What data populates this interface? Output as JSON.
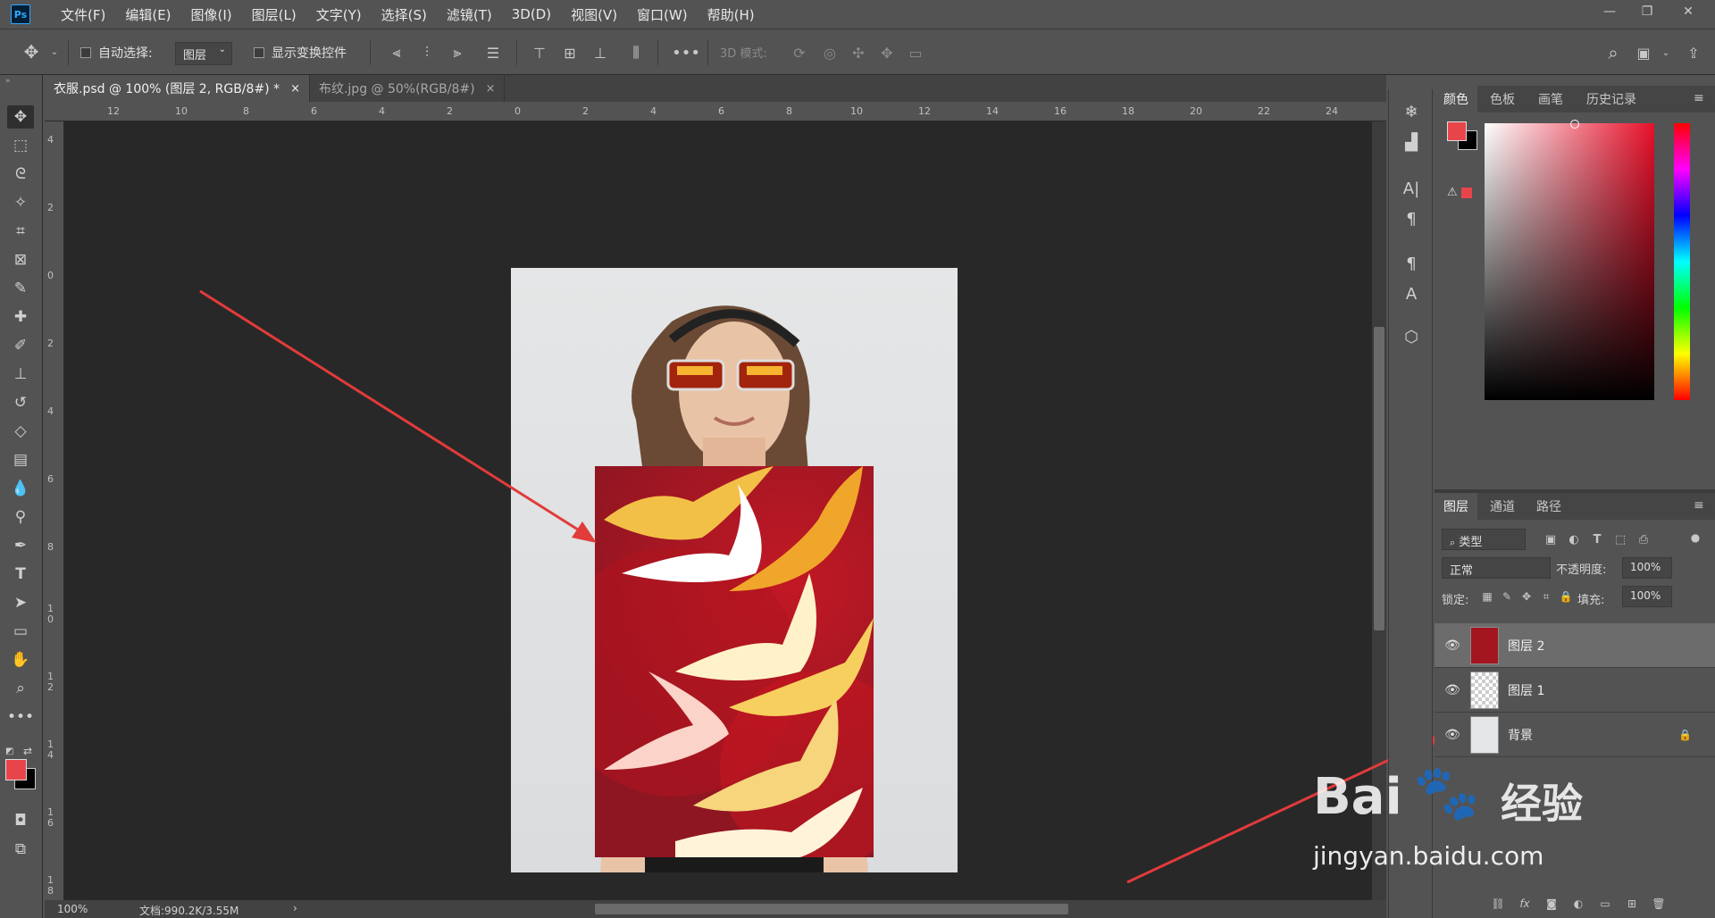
{
  "app": {
    "logo": "Ps"
  },
  "menu": [
    "文件(F)",
    "编辑(E)",
    "图像(I)",
    "图层(L)",
    "文字(Y)",
    "选择(S)",
    "滤镜(T)",
    "3D(D)",
    "视图(V)",
    "窗口(W)",
    "帮助(H)"
  ],
  "window_controls": {
    "minimize": "—",
    "restore": "❐",
    "close": "✕"
  },
  "options": {
    "auto_select_label": "自动选择:",
    "auto_select_value": "图层",
    "show_transform_label": "显示变换控件",
    "mode_3d_label": "3D 模式:"
  },
  "tabs": [
    {
      "label": "衣服.psd @ 100% (图层 2, RGB/8#) *",
      "close": "×"
    },
    {
      "label": "布纹.jpg @ 50%(RGB/8#)",
      "close": "×"
    }
  ],
  "ruler_h": [
    "12",
    "10",
    "8",
    "6",
    "4",
    "2",
    "0",
    "2",
    "4",
    "6",
    "8",
    "10",
    "12",
    "14",
    "16",
    "18",
    "20",
    "22",
    "24"
  ],
  "ruler_v": [
    "4",
    "2",
    "0",
    "2",
    "4",
    "6",
    "8",
    "1 0",
    "1 2",
    "1 4",
    "1 6",
    "1 8"
  ],
  "status": {
    "zoom": "100%",
    "doc_info": "文档:990.2K/3.55M",
    "arrow": "›"
  },
  "color_panel": {
    "tabs": [
      "颜色",
      "色板",
      "画笔",
      "历史记录"
    ],
    "foreground": "#e8454a",
    "background": "#000000"
  },
  "layers_panel": {
    "tabs": [
      "图层",
      "通道",
      "路径"
    ],
    "filter_label": "类型",
    "blend_mode": "正常",
    "opacity_label": "不透明度:",
    "opacity_value": "100%",
    "lock_label": "锁定:",
    "fill_label": "填充:",
    "fill_value": "100%",
    "layers": [
      {
        "name": "图层 2",
        "selected": true
      },
      {
        "name": "图层 1",
        "selected": false
      },
      {
        "name": "背景",
        "selected": false,
        "locked": true
      }
    ]
  },
  "watermark": {
    "brand": "Bai",
    "brand_cn": "经验",
    "url": "jingyan.baidu.com"
  },
  "accent_colors": {
    "arrow": "#e23b3b",
    "ps_blue": "#31a8ff",
    "fabric_red": "#a3151f"
  }
}
